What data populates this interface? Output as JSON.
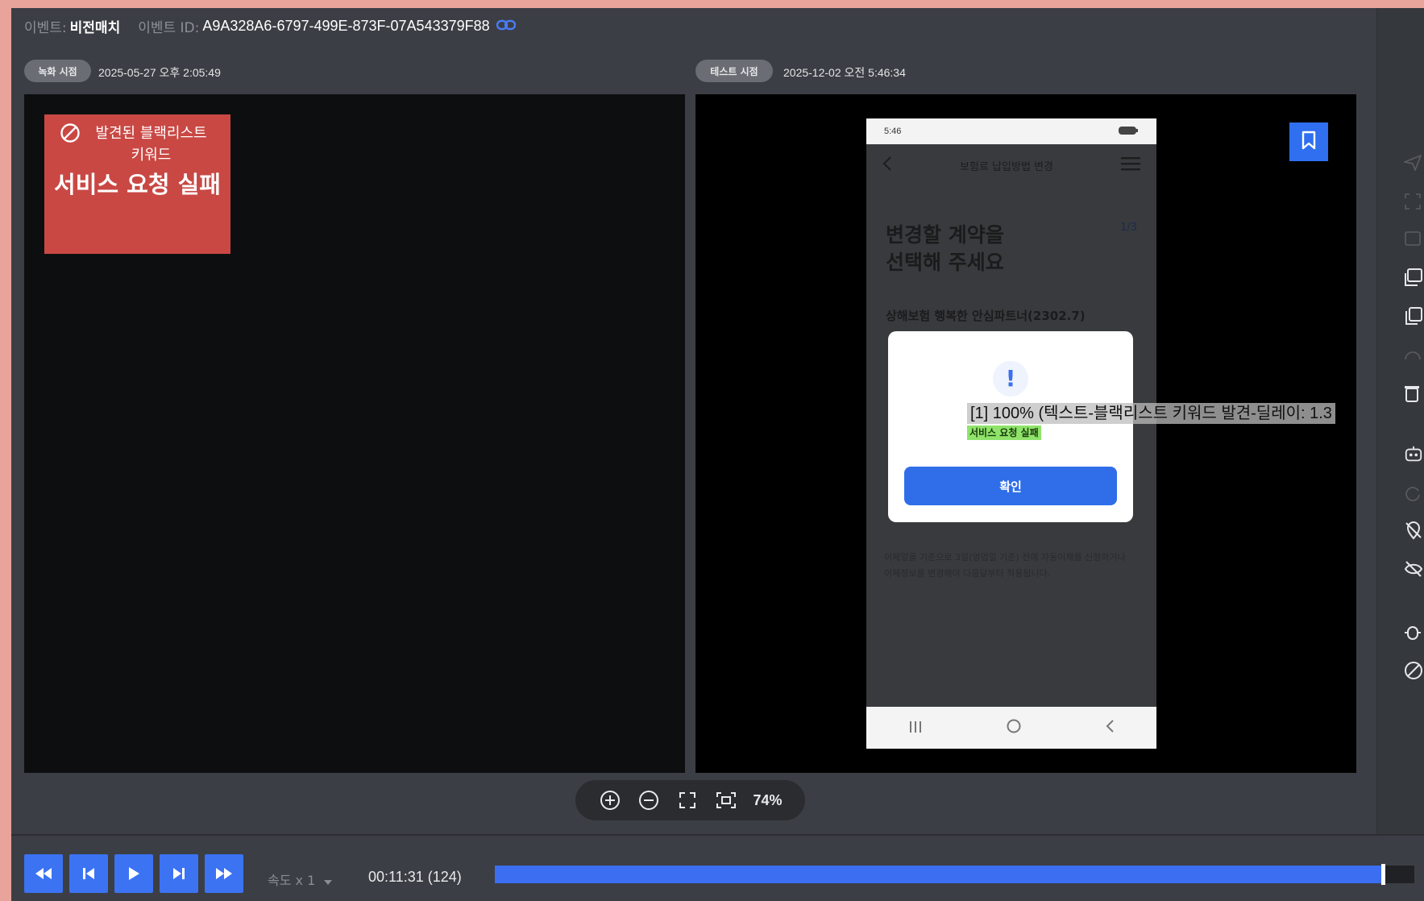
{
  "header": {
    "event_label": "이벤트:",
    "event_value": "비전매치",
    "event_id_label": "이벤트 ID:",
    "event_id_value": "A9A328A6-6797-499E-873F-07A543379F88",
    "link_icon": "link-icon"
  },
  "left_pane": {
    "pill": "녹화 시점",
    "timestamp": "2025-05-27 오후 2:05:49",
    "card": {
      "icon": "blocked-icon",
      "title": "발견된 블랙리스트 키워드",
      "message": "서비스 요청 실패"
    }
  },
  "right_pane": {
    "pill": "테스트 시점",
    "timestamp": "2025-12-02 오전 5:46:34",
    "bookmark_icon": "bookmark-icon",
    "phone": {
      "status_time": "5:46",
      "title": "보험료 납입방법 변경",
      "question_line1": "변경할 계약을",
      "question_line2": "선택해 주세요",
      "page": "1/3",
      "contract": "상해보험 행복한 안심파트너(2302.7)",
      "notes": "이체일을 기준으로 3일(영업일 기준) 전에 자동이체를 신청하거나 이체정보를 변경해야 다음달부터 적용됩니다.",
      "dialog_icon": "!",
      "dialog_button": "확인"
    },
    "overlay": {
      "main": "[1] 100% (텍스트-블랙리스트 키워드 발견-딜레이: 1.3",
      "sub": "서비스 요청 실패"
    }
  },
  "zoom": {
    "zoom_in_icon": "zoom-in-icon",
    "zoom_out_icon": "zoom-out-icon",
    "fullscreen_icon": "fullscreen-icon",
    "fit_icon": "fit-screen-icon",
    "value": "74%"
  },
  "playback": {
    "speed": "속도 x 1",
    "time": "00:11:31 (124)",
    "progress": 0.967
  },
  "colors": {
    "accent": "#3c6ef2",
    "danger": "#c94844",
    "highlight": "#8fe36a"
  }
}
